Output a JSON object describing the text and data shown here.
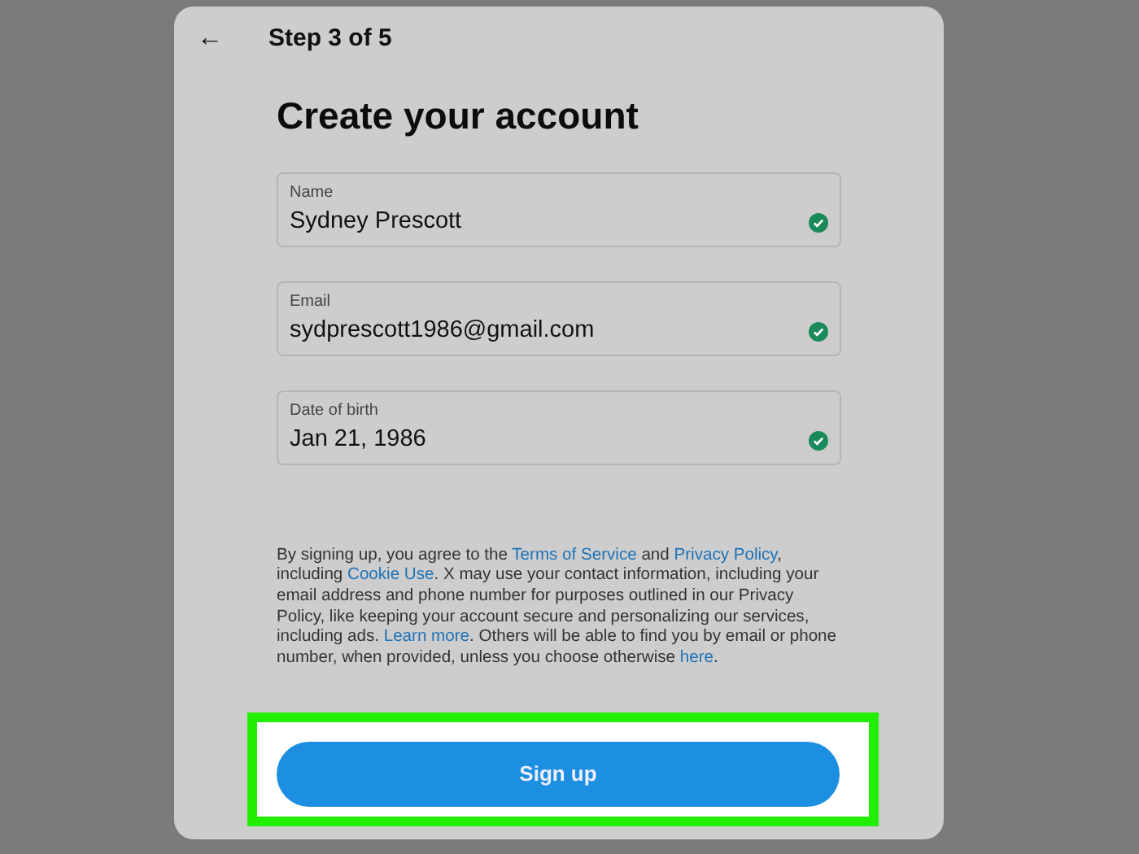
{
  "header": {
    "back": "←",
    "step": "Step 3 of 5"
  },
  "title": "Create your account",
  "fields": [
    {
      "label": "Name",
      "value": "Sydney Prescott",
      "valid": true
    },
    {
      "label": "Email",
      "value": "sydprescott1986@gmail.com",
      "valid": true
    },
    {
      "label": "Date of birth",
      "value": "Jan 21, 1986",
      "valid": true
    }
  ],
  "legal": [
    {
      "text": "By signing up, you agree to the ",
      "link": false
    },
    {
      "text": "Terms of Service",
      "link": true
    },
    {
      "text": " and ",
      "link": false
    },
    {
      "text": "Privacy Policy",
      "link": true
    },
    {
      "text": ", including ",
      "link": false
    },
    {
      "text": "Cookie Use",
      "link": true
    },
    {
      "text": ". X may use your contact information, including your email address and phone number for purposes outlined in our Privacy Policy, like keeping your account secure and personalizing our services, including ads. ",
      "link": false
    },
    {
      "text": "Learn more",
      "link": true
    },
    {
      "text": ". Others will be able to find you by email or phone number, when provided, unless you choose otherwise ",
      "link": false
    },
    {
      "text": "here",
      "link": true
    },
    {
      "text": ".",
      "link": false
    }
  ],
  "signup": {
    "label": "Sign up",
    "highlighted": true
  }
}
